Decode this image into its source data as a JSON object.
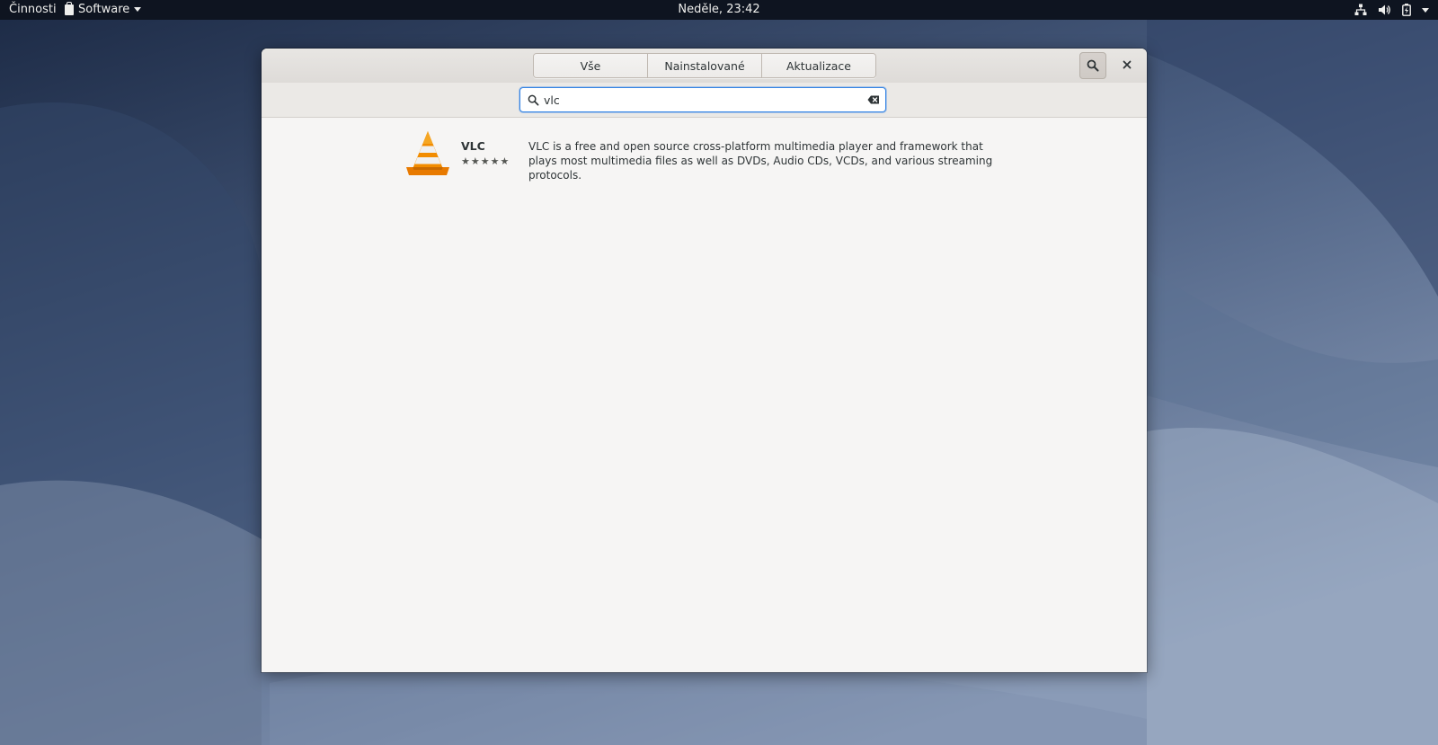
{
  "topbar": {
    "activities_label": "Činnosti",
    "app_menu_label": "Software",
    "clock": "Neděle, 23:42"
  },
  "window": {
    "tabs": [
      {
        "label": "Vše"
      },
      {
        "label": "Nainstalované"
      },
      {
        "label": "Aktualizace"
      }
    ],
    "search": {
      "value": "vlc",
      "placeholder": ""
    },
    "results": [
      {
        "name": "VLC",
        "rating_stars": 5,
        "description": "VLC is a free and open source cross-platform multimedia player and framework that plays most multimedia files as well as DVDs, Audio CDs, VCDs, and various streaming protocols."
      }
    ]
  },
  "icons": {
    "search": "search-icon",
    "close": "close-icon",
    "clear": "edit-clear-icon",
    "network": "network-icon",
    "volume": "volume-icon",
    "battery": "battery-icon",
    "app_menu": "software-bag-icon"
  },
  "colors": {
    "topbar_bg": "#0e1420",
    "accent": "#3584e4",
    "window_bg": "#f6f5f4",
    "vlc_orange": "#f28c00"
  }
}
